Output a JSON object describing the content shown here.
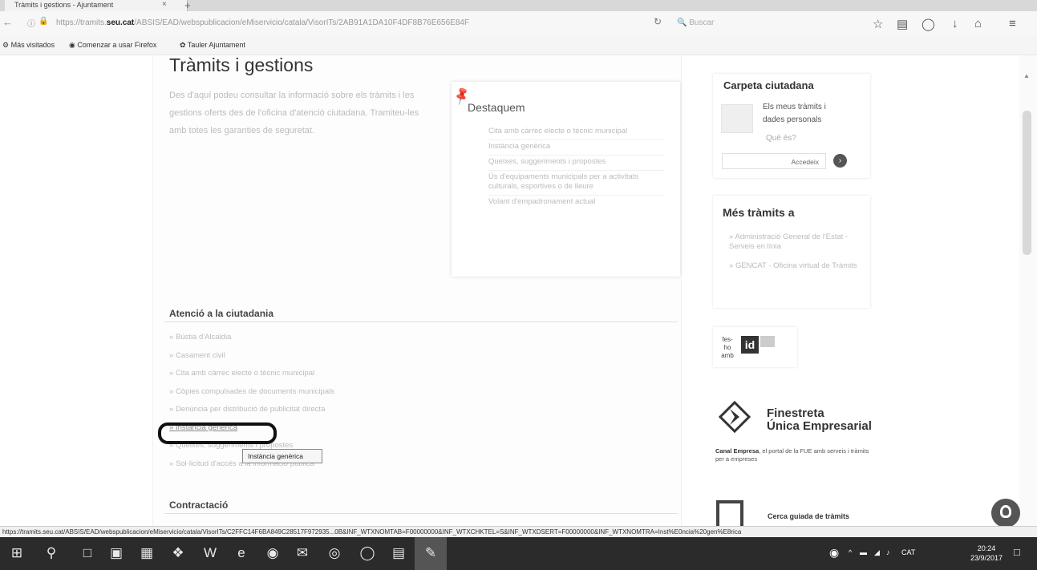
{
  "browser": {
    "tab_title": "Tràmits i gestions - Ajuntament",
    "tab_close": "×",
    "new_tab": "+",
    "url_prefix": "https://tramits.",
    "url_domain": "seu.cat",
    "url_rest": "/ABSIS/EAD/webspublicacion/eMiservicio/catala/VisorITs/2AB91A1DA10F4DF8B76E656E84F",
    "search_placeholder": "Buscar",
    "bookmarks": [
      "Más visitados",
      "Comenzar a usar Firefox",
      "Tauler Ajuntament"
    ],
    "status_url": "https://tramits.seu.cat/ABSIS/EAD/webspublicacion/eMiservicio/catala/VisorITs/C2FFC14F6BA849C28517F972935...0B&INF_WTXNOMTAB=F00000000&INF_WTXCHKTEL=S&INF_WTXDSERT=F00000000&INF_WTXNOMTRA=Inst%E0ncia%20gen%E8rica"
  },
  "page": {
    "title": "Tràmits i gestions",
    "intro": "Des d'aquí podeu consultar la informació sobre els tràmits i les gestions oferts des de l'oficina d'atenció ciutadana. Tramiteu-les amb totes les garanties de seguretat.",
    "highlight_title": "Destaquem",
    "highlight_items": [
      "Cita amb càrrec electe o tècnic municipal",
      "Instància genèrica",
      "Queixes, suggeriments i propostes",
      "Ús d'equipaments municipals per a activitats culturals, esportives o de lleure",
      "Volant d'empadronament actual"
    ],
    "section_atc": "Atenció a la ciutadania",
    "atc_items": [
      "Bústia d'Alcaldia",
      "Casament civil",
      "Cita amb càrrec electe o tècnic municipal",
      "Còpies compulsades de documents municipals",
      "Denúncia per distribució de publicitat directa",
      "Instància genèrica",
      "Queixes, suggeriments i propostes",
      "Sol·licitud d'accés a la informació pública"
    ],
    "tooltip": "Instància genèrica",
    "section_contract": "Contractació"
  },
  "sidebar": {
    "carpeta_title": "Carpeta ciutadana",
    "carpeta_desc": "Els meus tràmits i dades personals",
    "carpeta_what": "Què és?",
    "accedir": "Accedeix",
    "mes_title": "Més tràmits a",
    "mes_items": [
      "Administració General de l'Estat - Serveis en línia",
      "GENCAT - Oficina virtual de Tràmits"
    ],
    "fesho": "fes-ho amb",
    "idcat": "id",
    "fue_title_1": "Finestreta",
    "fue_title_2": "Única Empresarial",
    "fue_sub_bold": "Canal Empresa",
    "fue_sub": ", el portal de la FUE amb serveis i tràmits per a empreses",
    "cerca": "Cerca guiada de tràmits"
  },
  "taskbar": {
    "lang": "CAT",
    "time": "20:24",
    "date": "23/9/2017"
  }
}
